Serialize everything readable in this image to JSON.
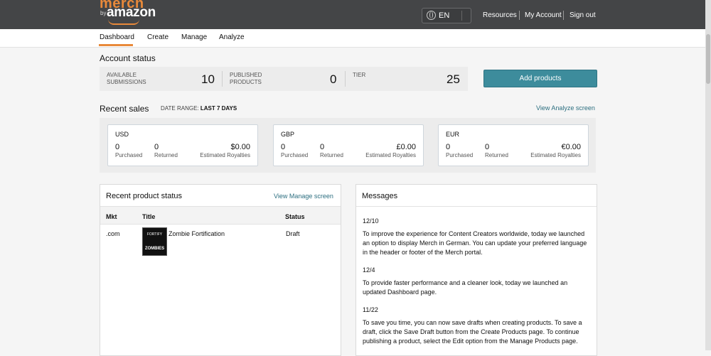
{
  "brand": {
    "merch": "merch",
    "by": "by",
    "amazon": "amazon"
  },
  "header": {
    "language": "EN",
    "links": [
      "Resources",
      "My Account",
      "Sign out"
    ]
  },
  "nav": {
    "tabs": [
      "Dashboard",
      "Create",
      "Manage",
      "Analyze"
    ],
    "active": "Dashboard"
  },
  "account_status": {
    "title": "Account status",
    "available_label": "AVAILABLE SUBMISSIONS",
    "available_l1": "AVAILABLE",
    "available_l2": "SUBMISSIONS",
    "available_value": "10",
    "published_l1": "PUBLISHED",
    "published_l2": "PRODUCTS",
    "published_value": "0",
    "tier_label": "TIER",
    "tier_value": "25",
    "add_button": "Add products"
  },
  "recent_sales": {
    "title": "Recent sales",
    "date_range_label": "DATE RANGE:",
    "date_range_value": "LAST 7 DAYS",
    "link": "View Analyze screen",
    "labels": {
      "purchased": "Purchased",
      "returned": "Returned",
      "royalties": "Estimated Royalties"
    },
    "currencies": [
      {
        "code": "USD",
        "purchased": "0",
        "returned": "0",
        "royalties": "$0.00"
      },
      {
        "code": "GBP",
        "purchased": "0",
        "returned": "0",
        "royalties": "£0.00"
      },
      {
        "code": "EUR",
        "purchased": "0",
        "returned": "0",
        "royalties": "€0.00"
      }
    ]
  },
  "product_status": {
    "title": "Recent product status",
    "link": "View Manage screen",
    "columns": [
      "Mkt",
      "Title",
      "Status"
    ],
    "rows": [
      {
        "mkt": ".com",
        "title": "Zombie Fortification",
        "status": "Draft",
        "thumb_top": "FORTIFY",
        "thumb_bottom": "ZOMBIES"
      }
    ]
  },
  "messages": {
    "title": "Messages",
    "items": [
      {
        "date": "12/10",
        "text": "To improve the experience for Content Creators worldwide, today we launched an option to display Merch in German. You can update your preferred language in the header or footer of the Merch portal."
      },
      {
        "date": "12/4",
        "text": "To provide faster performance and a cleaner look, today we launched an updated Dashboard page."
      },
      {
        "date": "11/22",
        "text": "To save you time, you can now save drafts when creating products. To save a draft, click the Save Draft button from the Create Products page. To continue publishing a product, select the Edit option from the Manage Products page."
      }
    ]
  },
  "colors": {
    "header_bg": "#444547",
    "accent_orange": "#e8893a",
    "button_teal": "#3d8c9c",
    "link_teal": "#2d6f80"
  }
}
